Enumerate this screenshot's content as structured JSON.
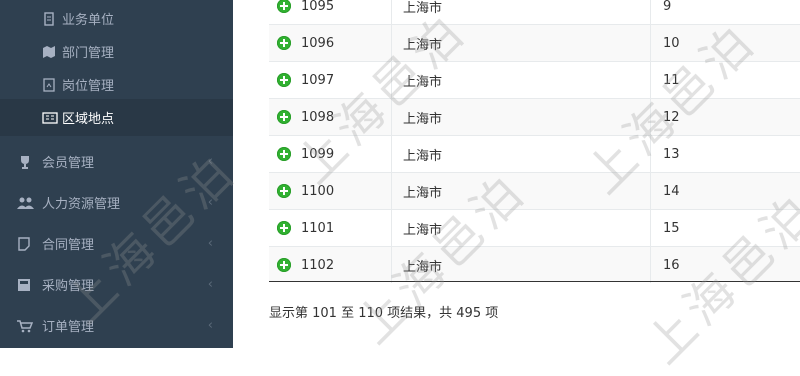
{
  "sidebar": {
    "sub_items": [
      {
        "label": "业务单位",
        "icon": "document-icon"
      },
      {
        "label": "部门管理",
        "icon": "map-icon"
      },
      {
        "label": "岗位管理",
        "icon": "file-icon"
      },
      {
        "label": "区域地点",
        "icon": "id-card-icon"
      }
    ],
    "nav_items": [
      {
        "label": "会员管理",
        "icon": "trophy-icon"
      },
      {
        "label": "人力资源管理",
        "icon": "users-icon"
      },
      {
        "label": "合同管理",
        "icon": "contract-icon"
      },
      {
        "label": "采购管理",
        "icon": "purchase-icon"
      },
      {
        "label": "订单管理",
        "icon": "cart-icon"
      }
    ],
    "chevron": "‹"
  },
  "table": {
    "rows": [
      {
        "id": "1095",
        "city": "上海市",
        "num": "9"
      },
      {
        "id": "1096",
        "city": "上海市",
        "num": "10"
      },
      {
        "id": "1097",
        "city": "上海市",
        "num": "11"
      },
      {
        "id": "1098",
        "city": "上海市",
        "num": "12"
      },
      {
        "id": "1099",
        "city": "上海市",
        "num": "13"
      },
      {
        "id": "1100",
        "city": "上海市",
        "num": "14"
      },
      {
        "id": "1101",
        "city": "上海市",
        "num": "15"
      },
      {
        "id": "1102",
        "city": "上海市",
        "num": "16"
      }
    ]
  },
  "footer": {
    "summary": "显示第 101 至 110 项结果，共 495 项"
  },
  "watermark": {
    "text": "上海邑泊"
  },
  "colors": {
    "sidebar": "#2f4050",
    "accent": "#31b131"
  }
}
